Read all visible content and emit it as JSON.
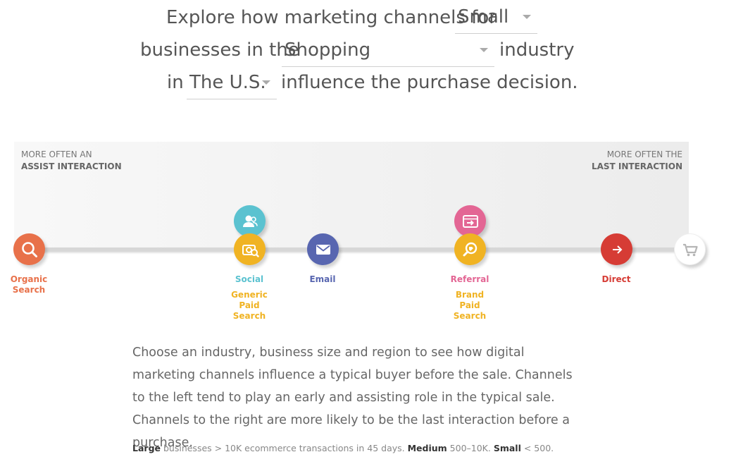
{
  "header": {
    "line1_prefix": "Explore how marketing channels for",
    "line2_prefix": "businesses in the",
    "line2_suffix": "industry",
    "line3_prefix": "in",
    "line3_suffix": "influence the purchase decision."
  },
  "selects": {
    "business_size": "Small",
    "industry": "Shopping",
    "region": "The U.S."
  },
  "band": {
    "left_top": "MORE OFTEN AN",
    "left_bottom": "ASSIST INTERACTION",
    "right_top": "MORE OFTEN THE",
    "right_bottom": "LAST INTERACTION"
  },
  "channels": {
    "organic": {
      "label1": "Organic",
      "label2": "Search",
      "icon": "search-icon",
      "color": "#e8714a"
    },
    "social": {
      "label": "Social",
      "icon": "people-icon",
      "color": "#5bc2d0"
    },
    "generic_paid": {
      "label1": "Generic",
      "label2": "Paid",
      "label3": "Search",
      "icon": "search-dollar-icon",
      "color": "#f0b323"
    },
    "email": {
      "label": "Email",
      "icon": "envelope-icon",
      "color": "#5866b0"
    },
    "referral": {
      "label": "Referral",
      "icon": "browser-arrow-icon",
      "color": "#e36694"
    },
    "brand_paid": {
      "label1": "Brand",
      "label2": "Paid",
      "label3": "Search",
      "icon": "tag-search-icon",
      "color": "#f0b323"
    },
    "direct": {
      "label": "Direct",
      "icon": "arrow-right-icon",
      "color": "#d63c35"
    },
    "purchase": {
      "icon": "shopping-cart-icon",
      "color": "#ffffff"
    }
  },
  "description": "Choose an industry, business size and region to see how digital marketing channels influence a typical buyer before the sale. Channels to the left tend to play an early and assisting role in the typical sale. Channels to the right are more likely to be the last interaction before a purchase.",
  "footnote": {
    "large": "Large",
    "large_text": " businesses > 10K ecommerce transactions in 45 days. ",
    "medium": "Medium",
    "medium_text": " 500–10K. ",
    "small": "Small",
    "small_text": " < 500."
  }
}
